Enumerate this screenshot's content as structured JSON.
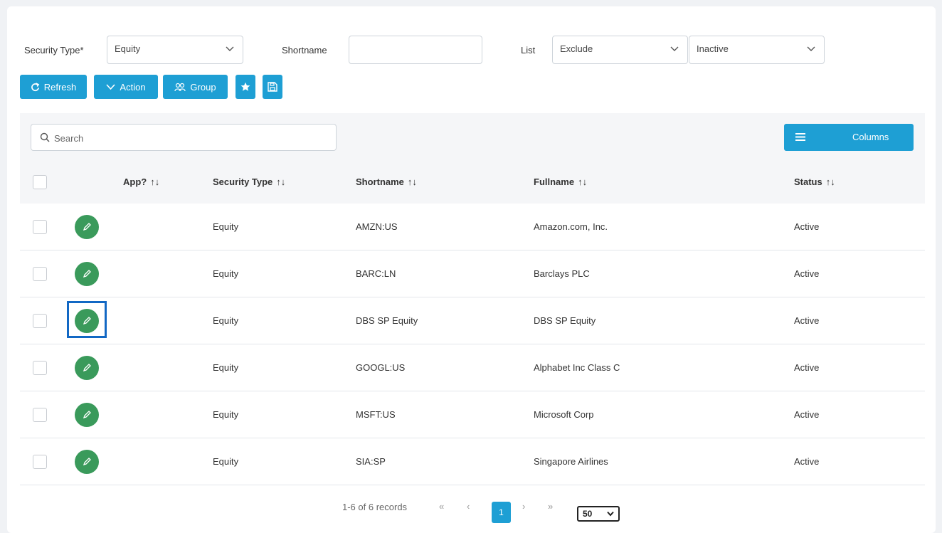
{
  "filters": {
    "security_type_label": "Security Type*",
    "security_type_value": "Equity",
    "shortname_label": "Shortname",
    "shortname_value": "",
    "list_label": "List",
    "list_value": "Exclude",
    "status_value": "Inactive"
  },
  "toolbar": {
    "refresh_label": "Refresh",
    "action_label": "Action",
    "group_label": "Group"
  },
  "search": {
    "placeholder": "Search"
  },
  "columns_button": "Columns",
  "table": {
    "headers": [
      "App?",
      "Security Type",
      "Shortname",
      "Fullname",
      "Status"
    ],
    "sort_glyph": "↑↓",
    "rows": [
      {
        "security_type": "Equity",
        "shortname": "AMZN:US",
        "fullname": "Amazon.com, Inc.",
        "status": "Active"
      },
      {
        "security_type": "Equity",
        "shortname": "BARC:LN",
        "fullname": "Barclays PLC",
        "status": "Active"
      },
      {
        "security_type": "Equity",
        "shortname": "DBS SP Equity",
        "fullname": "DBS SP Equity",
        "status": "Active"
      },
      {
        "security_type": "Equity",
        "shortname": "GOOGL:US",
        "fullname": "Alphabet Inc Class C",
        "status": "Active"
      },
      {
        "security_type": "Equity",
        "shortname": "MSFT:US",
        "fullname": "Microsoft Corp",
        "status": "Active"
      },
      {
        "security_type": "Equity",
        "shortname": "SIA:SP",
        "fullname": "Singapore Airlines",
        "status": "Active"
      }
    ]
  },
  "pagination": {
    "records_text": "1-6 of 6 records",
    "first": "«",
    "prev": "‹",
    "current_page": "1",
    "next": "›",
    "last": "»",
    "rows_per_page": "50"
  },
  "colors": {
    "accent": "#1e9fd4",
    "edit_button": "#3a9a5b",
    "focus": "#1268c4"
  }
}
